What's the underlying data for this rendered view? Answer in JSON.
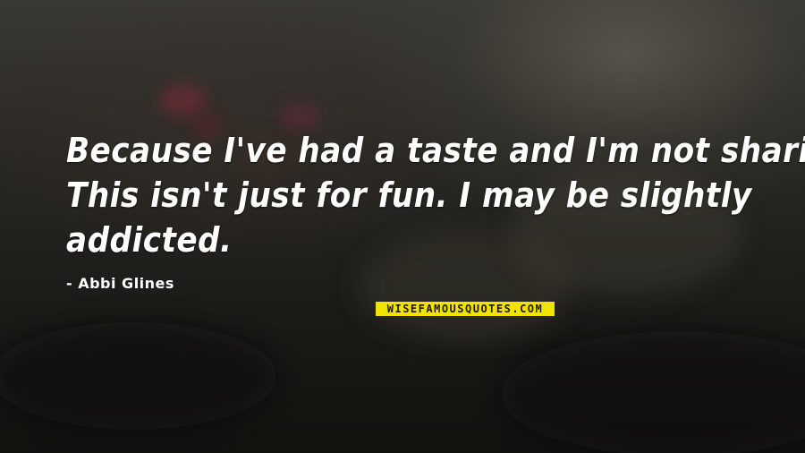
{
  "quote": {
    "lines": [
      "Because I've had a taste and I'm not sharing.",
      "This isn't just for fun. I may be slightly",
      "addicted."
    ]
  },
  "author": "- Abbi Glines",
  "watermark": "WISEFAMOUSQUOTES.COM",
  "colors": {
    "text": "#ffffff",
    "watermark_bg": "#f2e200",
    "background_dark": "#161511"
  }
}
